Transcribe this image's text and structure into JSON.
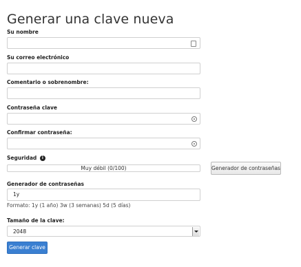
{
  "page": {
    "title": "Generar una clave nueva"
  },
  "form": {
    "name": {
      "label": "Su nombre",
      "value": "",
      "icon": "contact-card-icon"
    },
    "email": {
      "label": "Su correo electrónico",
      "value": ""
    },
    "comment": {
      "label": "Comentario o sobrenombre:",
      "value": ""
    },
    "password": {
      "label": "Contraseña clave",
      "value": "",
      "icon": "eye-icon"
    },
    "confirm": {
      "label": "Confirmar contraseña:",
      "value": "",
      "icon": "eye-icon"
    },
    "security": {
      "label": "Seguridad",
      "info_icon": "info-icon",
      "strength_text": "Muy débil (0/100)",
      "strength_level": 0
    },
    "generator_button": "Generador de contraseñas",
    "expiry": {
      "label": "Generador de contraseñas",
      "value": "1y",
      "format_hint": "Formato: 1y (1 año) 3w (3 semanas) 5d (5 días)"
    },
    "key_size": {
      "label": "Tamaño de la clave:",
      "selected": "2048"
    },
    "submit_label": "Generar clave"
  },
  "colors": {
    "primary_button": "#3a7fd1",
    "input_border": "#cfcfcf"
  }
}
